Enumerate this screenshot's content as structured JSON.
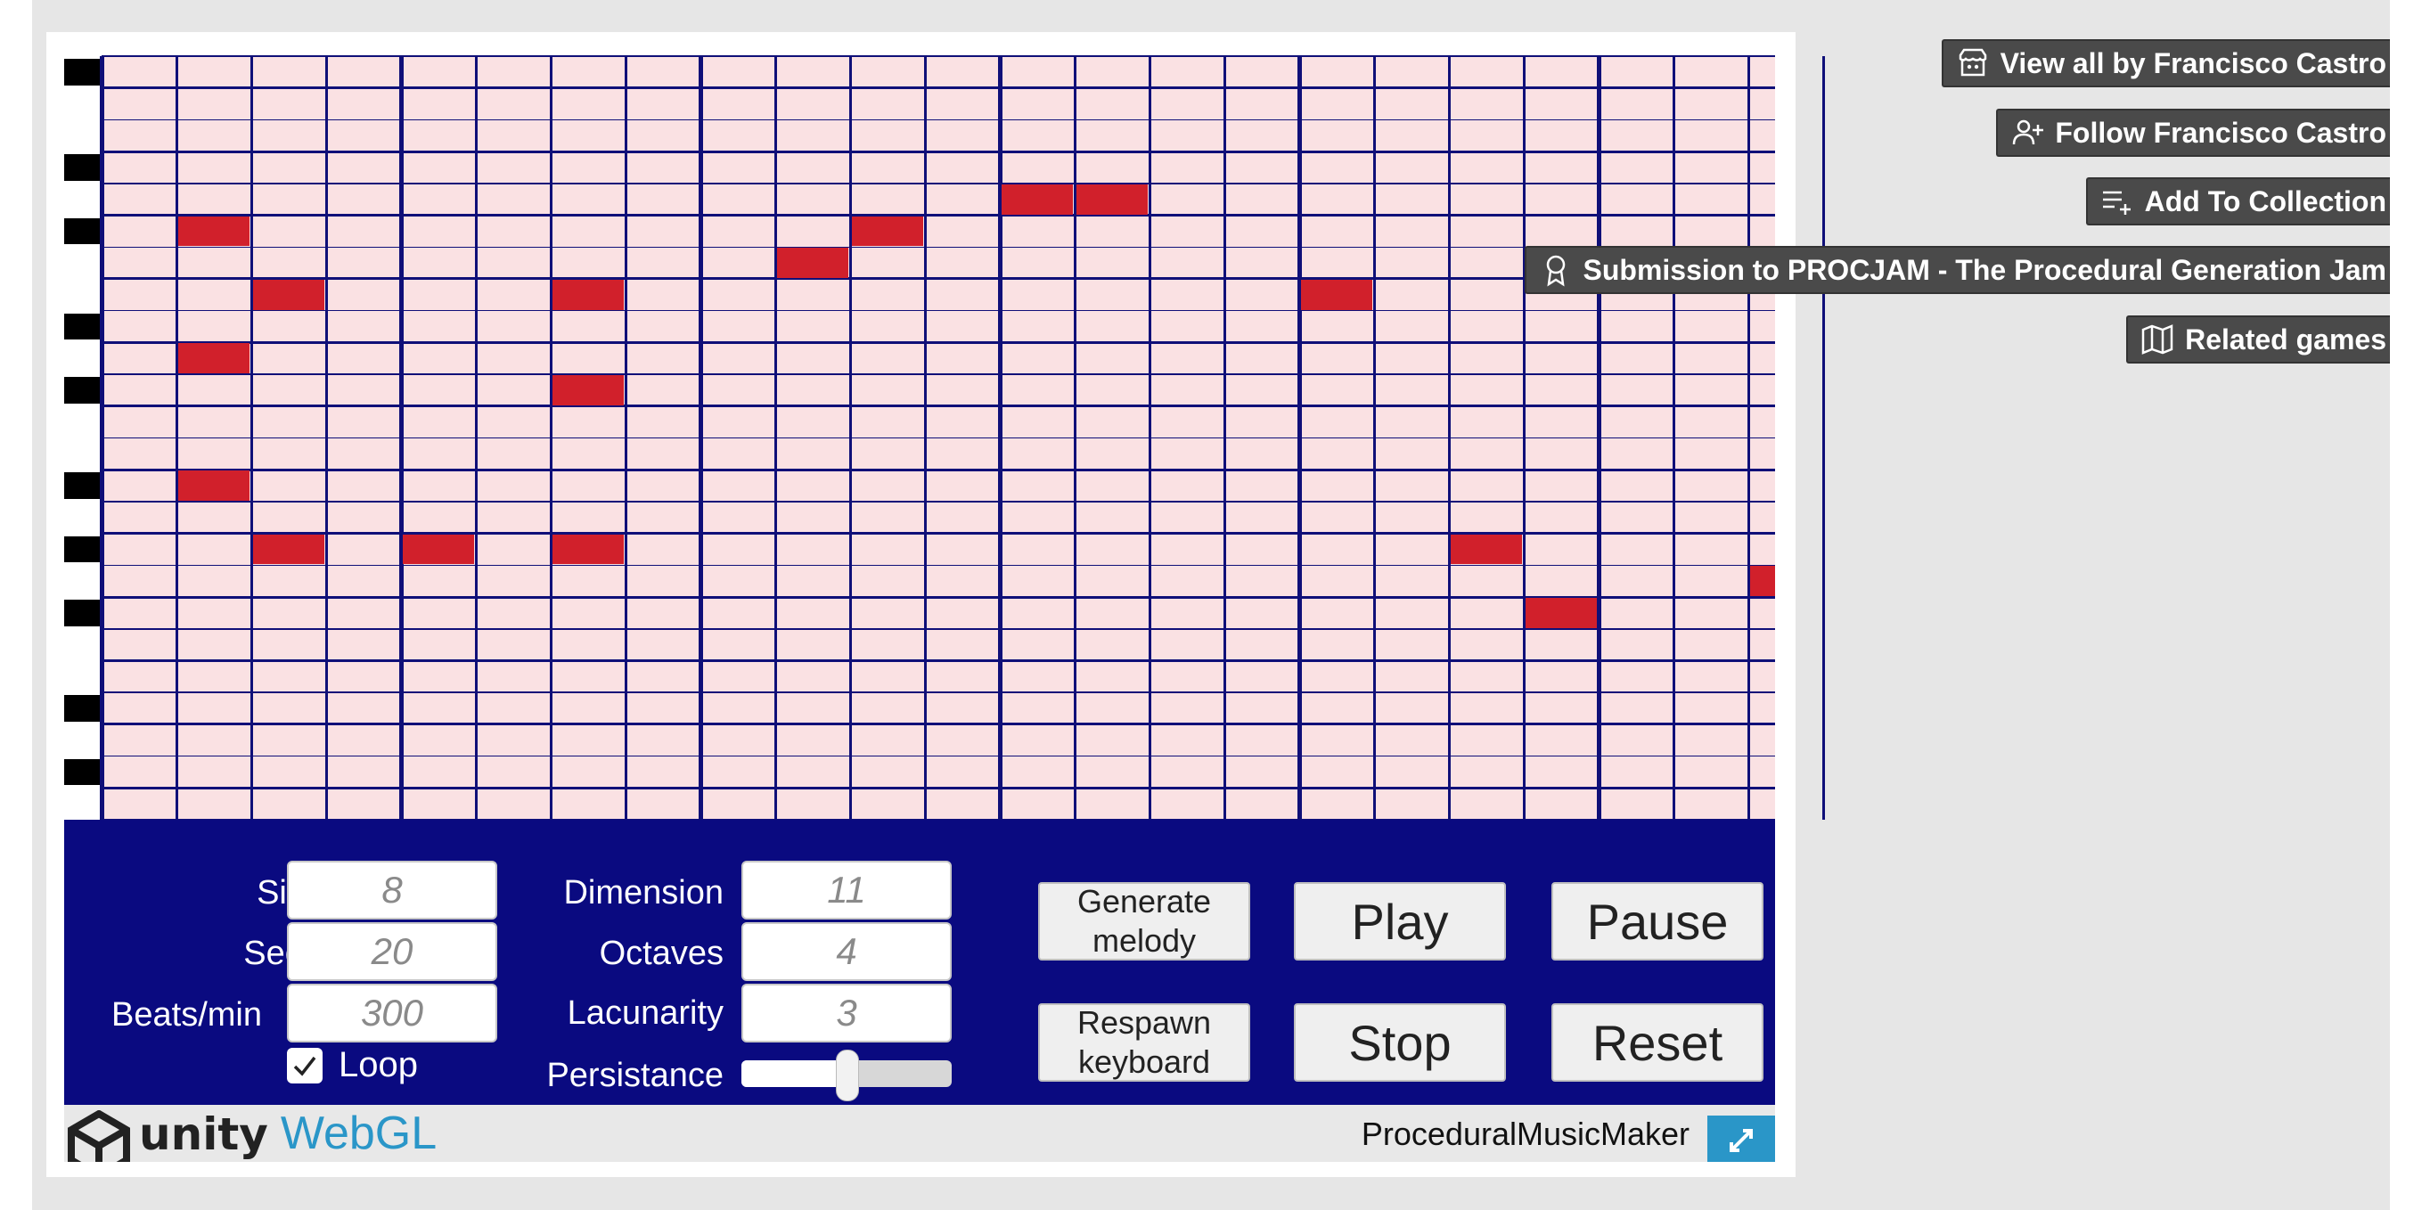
{
  "sidebar": {
    "buttons": [
      {
        "label": "View all by Francisco Castro",
        "icon": "itchio-icon"
      },
      {
        "label": "Follow Francisco Castro",
        "icon": "add-user-icon"
      },
      {
        "label": "Add To Collection",
        "icon": "add-list-icon"
      },
      {
        "label": "Submission to PROCJAM - The Procedural Generation Jam",
        "icon": "award-icon"
      },
      {
        "label": "Related games",
        "icon": "map-icon"
      }
    ]
  },
  "piano_roll": {
    "columns": 23,
    "rows": 24,
    "grid_color": "#0f0f78",
    "cell_color": "#fae1e3",
    "note_color": "#d1202b",
    "black_key_rows": [
      0,
      3,
      5,
      8,
      10,
      13,
      15,
      17,
      20,
      22
    ],
    "notes": [
      {
        "col": 1,
        "row": 5
      },
      {
        "col": 2,
        "row": 7
      },
      {
        "col": 1,
        "row": 9
      },
      {
        "col": 1,
        "row": 13
      },
      {
        "col": 2,
        "row": 15
      },
      {
        "col": 4,
        "row": 15
      },
      {
        "col": 6,
        "row": 7
      },
      {
        "col": 6,
        "row": 10
      },
      {
        "col": 6,
        "row": 15
      },
      {
        "col": 9,
        "row": 6
      },
      {
        "col": 10,
        "row": 5
      },
      {
        "col": 12,
        "row": 4
      },
      {
        "col": 13,
        "row": 4
      },
      {
        "col": 16,
        "row": 7
      },
      {
        "col": 18,
        "row": 15
      },
      {
        "col": 19,
        "row": 17
      },
      {
        "col": 22,
        "row": 16
      }
    ]
  },
  "controls": {
    "size_label": "Size",
    "size_value": "8",
    "seed_label": "Seed",
    "seed_value": "20",
    "bpm_label": "Beats/min",
    "bpm_value": "300",
    "loop_label": "Loop",
    "loop_checked": true,
    "dimension_label": "Dimension",
    "dimension_value": "11",
    "octaves_label": "Octaves",
    "octaves_value": "4",
    "lacunarity_label": "Lacunarity",
    "lacunarity_value": "3",
    "persistance_label": "Persistance",
    "persistance_value": 0.5,
    "generate_melody_label": "Generate\nmelody",
    "respawn_keyboard_label": "Respawn\nkeyboard",
    "play_label": "Play",
    "pause_label": "Pause",
    "stop_label": "Stop",
    "reset_label": "Reset"
  },
  "footer": {
    "unity_label": "unity",
    "webgl_label": "WebGL",
    "app_name": "ProceduralMusicMaker",
    "fullscreen_icon": "fullscreen-icon"
  }
}
